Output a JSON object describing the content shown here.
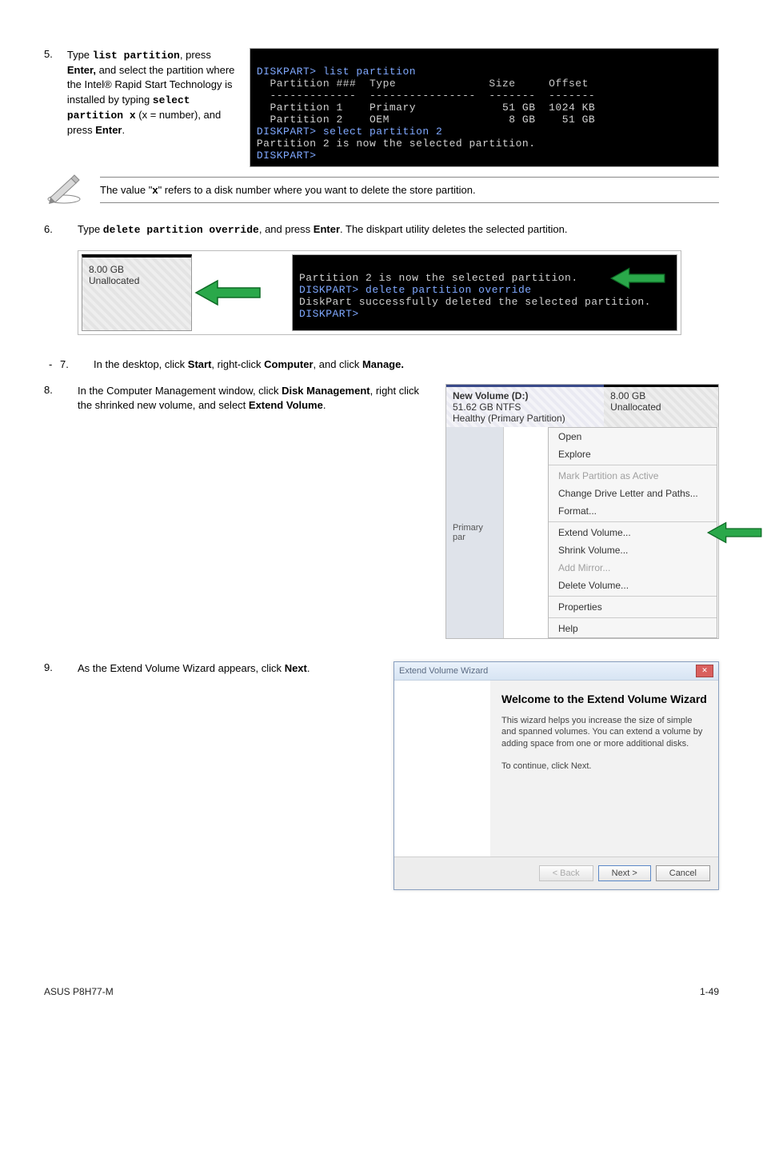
{
  "step5": {
    "num": "5.",
    "pre": "Type ",
    "code1": "list partition",
    "mid1": ", press ",
    "bold1": "Enter,",
    "mid2": " and select the partition where the Intel",
    "reg": "®",
    "mid3": " Rapid Start Technology is installed by typing ",
    "code2": "select partition x",
    "mid4": " (x = number), and press ",
    "bold2": "Enter",
    "end": "."
  },
  "term1": {
    "l1": "DISKPART> list partition",
    "hdr": "  Partition ###  Type              Size     Offset",
    "dash": "  -------------  ----------------  -------  -------",
    "p1": "  Partition 1    Primary             51 GB  1024 KB",
    "p2": "  Partition 2    OEM                  8 GB    51 GB",
    "l2": "DISKPART> select partition 2",
    "l3": "Partition 2 is now the selected partition.",
    "l4": "DISKPART>"
  },
  "note": {
    "pre": "The value \"",
    "x": "x",
    "post": "\" refers to a disk number where you want to delete the store partition."
  },
  "step6": {
    "num": "6.",
    "pre": "Type ",
    "code": "delete partition override",
    "mid": ", and press ",
    "bold": "Enter",
    "post": ". The diskpart utility deletes the selected partition."
  },
  "unalloc": {
    "size": "8.00 GB",
    "label": "Unallocated"
  },
  "term2": {
    "l1": "Partition 2 is now the selected partition.",
    "l2": "DISKPART> delete partition override",
    "l3": "DiskPart successfully deleted the selected partition.",
    "l4": "DISKPART>"
  },
  "step7": {
    "num": "7.",
    "pre": "In the desktop, click ",
    "b1": "Start",
    "mid1": ", right-click ",
    "b2": "Computer",
    "mid2": ", and click ",
    "b3": "Manage."
  },
  "step8": {
    "num": "8.",
    "l1": "In the Computer Management window, click ",
    "b1": "Disk Management",
    "l2": ", right click the shrinked new volume, and select ",
    "b2": "Extend Volume",
    "end": "."
  },
  "vol": {
    "title": "New Volume  (D:)",
    "size": "51.62 GB NTFS",
    "status": "Healthy (Primary Partition)",
    "un_size": "8.00 GB",
    "un_label": "Unallocated",
    "primary": "Primary par"
  },
  "menu": {
    "open": "Open",
    "explore": "Explore",
    "mark": "Mark Partition as Active",
    "change": "Change Drive Letter and Paths...",
    "format": "Format...",
    "extend": "Extend Volume...",
    "shrink": "Shrink Volume...",
    "mirror": "Add Mirror...",
    "delete": "Delete Volume...",
    "props": "Properties",
    "help": "Help"
  },
  "step9": {
    "num": "9.",
    "pre": "As the Extend Volume Wizard appears, click ",
    "b": "Next",
    "end": "."
  },
  "wizard": {
    "title": "Extend Volume Wizard",
    "h": "Welcome to the Extend Volume Wizard",
    "p1": "This wizard helps you increase the size of simple and spanned volumes. You can extend a volume by adding space from one or more additional disks.",
    "p2": "To continue, click Next.",
    "back": "< Back",
    "next": "Next >",
    "cancel": "Cancel"
  },
  "footer": {
    "left": "ASUS P8H77-M",
    "right": "1-49"
  }
}
